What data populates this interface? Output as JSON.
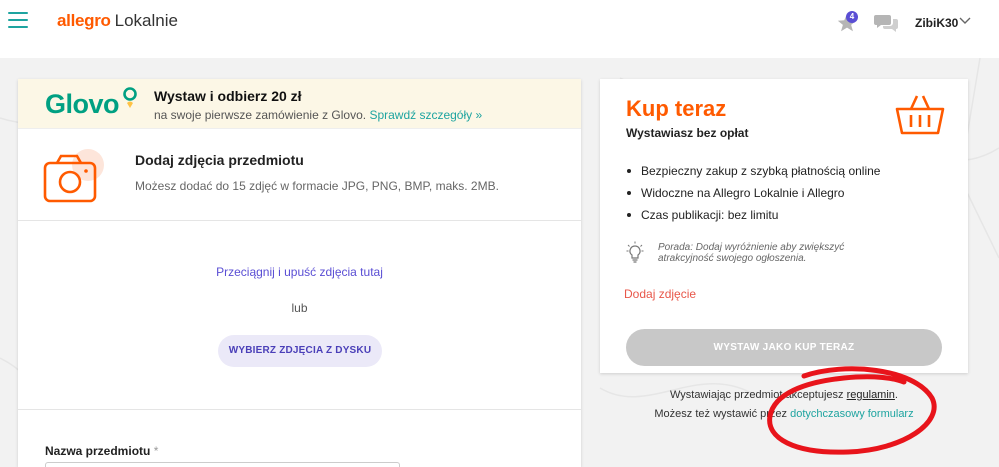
{
  "header": {
    "brand": "allegro",
    "brand_sub": "Lokalnie",
    "notification_count": "4",
    "username": "ZibiK30",
    "accent_color": "#1ea4a0",
    "brand_color": "#ff5a00"
  },
  "glovo": {
    "logo_text": "Glovo",
    "title": "Wystaw i odbierz 20 zł",
    "subtitle": "na swoje pierwsze zamówienie z Glovo.",
    "link": "Sprawdź szczegóły »"
  },
  "photos": {
    "title": "Dodaj zdjęcia przedmiotu",
    "description": "Możesz dodać do 15 zdjęć w formacie JPG, PNG, BMP, maks. 2MB.",
    "drop_text": "Przeciągnij i upuść zdjęcia tutaj",
    "or_text": "lub",
    "choose_button": "WYBIERZ ZDJĘCIA Z DYSKU"
  },
  "item_name": {
    "label": "Nazwa przedmiotu",
    "required_mark": "*"
  },
  "buy_now": {
    "title": "Kup teraz",
    "subtitle": "Wystawiasz bez opłat",
    "features": [
      "Bezpieczny zakup z szybką płatnością online",
      "Widoczne na Allegro Lokalnie i Allegro",
      "Czas publikacji: bez limitu"
    ],
    "tip": "Porada: Dodaj wyróżnienie aby zwiększyć atrakcyjność swojego ogłoszenia.",
    "add_photo_link": "Dodaj zdjęcie",
    "publish_button": "WYSTAW JAKO KUP TERAZ"
  },
  "footer": {
    "terms_prefix": "Wystawiając przedmiot akceptujesz",
    "terms_link": "regulamin",
    "terms_suffix": ".",
    "old_form_prefix": "Możesz też wystawić przez",
    "old_form_link": "dotychczasowy formularz"
  }
}
